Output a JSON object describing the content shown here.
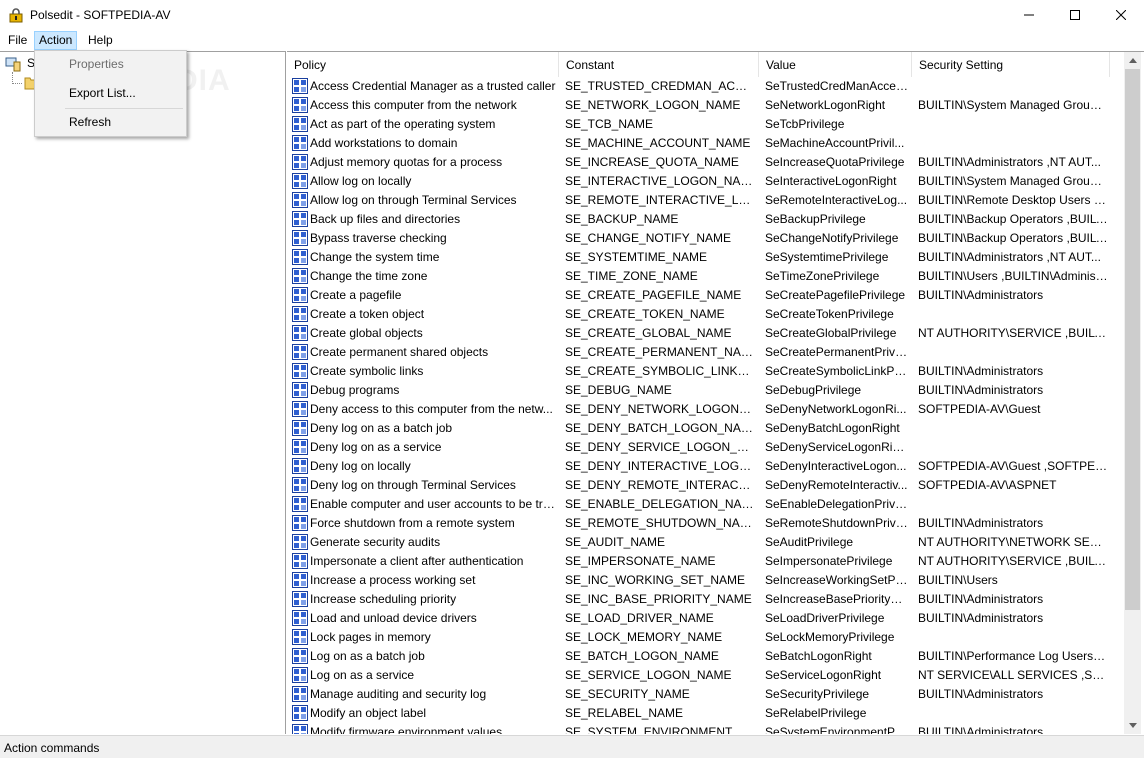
{
  "window": {
    "title": "Polsedit - SOFTPEDIA-AV"
  },
  "menu": {
    "file": "File",
    "action": "Action",
    "help": "Help"
  },
  "action_menu": {
    "properties": "Properties",
    "export": "Export List...",
    "refresh": "Refresh"
  },
  "tree": {
    "root_label": "S"
  },
  "watermark": "SOFTPEDIA",
  "columns": {
    "policy": "Policy",
    "constant": "Constant",
    "value": "Value",
    "security": "Security Setting"
  },
  "rows": [
    {
      "policy": "Access Credential Manager as a trusted caller",
      "constant": "SE_TRUSTED_CREDMAN_ACCESS...",
      "value": "SeTrustedCredManAcces...",
      "security": ""
    },
    {
      "policy": "Access this computer from the network",
      "constant": "SE_NETWORK_LOGON_NAME",
      "value": "SeNetworkLogonRight",
      "security": "BUILTIN\\System Managed Group ..."
    },
    {
      "policy": "Act as part of the operating system",
      "constant": "SE_TCB_NAME",
      "value": "SeTcbPrivilege",
      "security": ""
    },
    {
      "policy": "Add workstations to domain",
      "constant": "SE_MACHINE_ACCOUNT_NAME",
      "value": "SeMachineAccountPrivil...",
      "security": ""
    },
    {
      "policy": "Adjust memory quotas for a process",
      "constant": "SE_INCREASE_QUOTA_NAME",
      "value": "SeIncreaseQuotaPrivilege",
      "security": "BUILTIN\\Administrators ,NT AUT..."
    },
    {
      "policy": "Allow log on locally",
      "constant": "SE_INTERACTIVE_LOGON_NAME",
      "value": "SeInteractiveLogonRight",
      "security": "BUILTIN\\System Managed Group ..."
    },
    {
      "policy": "Allow log on through Terminal Services",
      "constant": "SE_REMOTE_INTERACTIVE_LOGO...",
      "value": "SeRemoteInteractiveLog...",
      "security": "BUILTIN\\Remote Desktop Users ,B..."
    },
    {
      "policy": "Back up files and directories",
      "constant": "SE_BACKUP_NAME",
      "value": "SeBackupPrivilege",
      "security": "BUILTIN\\Backup Operators ,BUILT..."
    },
    {
      "policy": "Bypass traverse checking",
      "constant": "SE_CHANGE_NOTIFY_NAME",
      "value": "SeChangeNotifyPrivilege",
      "security": "BUILTIN\\Backup Operators ,BUILT..."
    },
    {
      "policy": "Change the system time",
      "constant": "SE_SYSTEMTIME_NAME",
      "value": "SeSystemtimePrivilege",
      "security": "BUILTIN\\Administrators ,NT AUT..."
    },
    {
      "policy": "Change the time zone",
      "constant": "SE_TIME_ZONE_NAME",
      "value": "SeTimeZonePrivilege",
      "security": "BUILTIN\\Users ,BUILTIN\\Administ..."
    },
    {
      "policy": "Create a pagefile",
      "constant": "SE_CREATE_PAGEFILE_NAME",
      "value": "SeCreatePagefilePrivilege",
      "security": "BUILTIN\\Administrators"
    },
    {
      "policy": "Create a token object",
      "constant": "SE_CREATE_TOKEN_NAME",
      "value": "SeCreateTokenPrivilege",
      "security": ""
    },
    {
      "policy": "Create global objects",
      "constant": "SE_CREATE_GLOBAL_NAME",
      "value": "SeCreateGlobalPrivilege",
      "security": "NT AUTHORITY\\SERVICE ,BUILTI..."
    },
    {
      "policy": "Create permanent shared objects",
      "constant": "SE_CREATE_PERMANENT_NAME",
      "value": "SeCreatePermanentPrivil...",
      "security": ""
    },
    {
      "policy": "Create symbolic links",
      "constant": "SE_CREATE_SYMBOLIC_LINK_NA...",
      "value": "SeCreateSymbolicLinkPri...",
      "security": "BUILTIN\\Administrators"
    },
    {
      "policy": "Debug programs",
      "constant": "SE_DEBUG_NAME",
      "value": "SeDebugPrivilege",
      "security": "BUILTIN\\Administrators"
    },
    {
      "policy": "Deny access to this computer from the netw...",
      "constant": "SE_DENY_NETWORK_LOGON_NA...",
      "value": "SeDenyNetworkLogonRi...",
      "security": "SOFTPEDIA-AV\\Guest"
    },
    {
      "policy": "Deny log on as a batch job",
      "constant": "SE_DENY_BATCH_LOGON_NAME",
      "value": "SeDenyBatchLogonRight",
      "security": ""
    },
    {
      "policy": "Deny log on as a service",
      "constant": "SE_DENY_SERVICE_LOGON_NAME",
      "value": "SeDenyServiceLogonRight",
      "security": ""
    },
    {
      "policy": "Deny log on locally",
      "constant": "SE_DENY_INTERACTIVE_LOGON_...",
      "value": "SeDenyInteractiveLogon...",
      "security": "SOFTPEDIA-AV\\Guest ,SOFTPEDI..."
    },
    {
      "policy": "Deny log on through Terminal Services",
      "constant": "SE_DENY_REMOTE_INTERACTIVE_...",
      "value": "SeDenyRemoteInteractiv...",
      "security": "SOFTPEDIA-AV\\ASPNET"
    },
    {
      "policy": "Enable computer and user accounts to be tru...",
      "constant": "SE_ENABLE_DELEGATION_NAME",
      "value": "SeEnableDelegationPrivil...",
      "security": ""
    },
    {
      "policy": "Force shutdown from a remote system",
      "constant": "SE_REMOTE_SHUTDOWN_NAME",
      "value": "SeRemoteShutdownPrivi...",
      "security": "BUILTIN\\Administrators"
    },
    {
      "policy": "Generate security audits",
      "constant": "SE_AUDIT_NAME",
      "value": "SeAuditPrivilege",
      "security": "NT AUTHORITY\\NETWORK SERVI..."
    },
    {
      "policy": "Impersonate a client after authentication",
      "constant": "SE_IMPERSONATE_NAME",
      "value": "SeImpersonatePrivilege",
      "security": "NT AUTHORITY\\SERVICE ,BUILTI..."
    },
    {
      "policy": "Increase a process working set",
      "constant": "SE_INC_WORKING_SET_NAME",
      "value": "SeIncreaseWorkingSetPri...",
      "security": "BUILTIN\\Users"
    },
    {
      "policy": "Increase scheduling priority",
      "constant": "SE_INC_BASE_PRIORITY_NAME",
      "value": "SeIncreaseBasePriorityPri...",
      "security": "BUILTIN\\Administrators"
    },
    {
      "policy": "Load and unload device drivers",
      "constant": "SE_LOAD_DRIVER_NAME",
      "value": "SeLoadDriverPrivilege",
      "security": "BUILTIN\\Administrators"
    },
    {
      "policy": "Lock pages in memory",
      "constant": "SE_LOCK_MEMORY_NAME",
      "value": "SeLockMemoryPrivilege",
      "security": ""
    },
    {
      "policy": "Log on as a batch job",
      "constant": "SE_BATCH_LOGON_NAME",
      "value": "SeBatchLogonRight",
      "security": "BUILTIN\\Performance Log Users ,..."
    },
    {
      "policy": "Log on as a service",
      "constant": "SE_SERVICE_LOGON_NAME",
      "value": "SeServiceLogonRight",
      "security": "NT SERVICE\\ALL SERVICES ,SOFT..."
    },
    {
      "policy": "Manage auditing and security log",
      "constant": "SE_SECURITY_NAME",
      "value": "SeSecurityPrivilege",
      "security": "BUILTIN\\Administrators"
    },
    {
      "policy": "Modify an object label",
      "constant": "SE_RELABEL_NAME",
      "value": "SeRelabelPrivilege",
      "security": ""
    },
    {
      "policy": "Modify firmware environment values",
      "constant": "SE_SYSTEM_ENVIRONMENT_NAME",
      "value": "SeSystemEnvironmentPri...",
      "security": "BUILTIN\\Administrators"
    }
  ],
  "status": {
    "text": "Action commands"
  }
}
